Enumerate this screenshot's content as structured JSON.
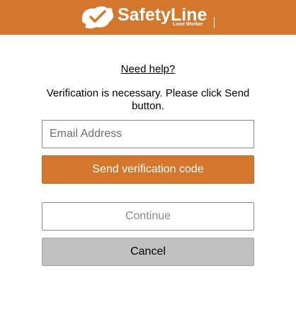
{
  "brand": {
    "name": "SafetyLine",
    "tagline": "Lone Worker",
    "color": "#d4772c",
    "icon": "safetyline-bird-logo-icon"
  },
  "help": {
    "label": "Need help?"
  },
  "message": "Verification is necessary. Please click Send button.",
  "email": {
    "placeholder": "Email Address",
    "value": ""
  },
  "buttons": {
    "send": "Send verification code",
    "continue": "Continue",
    "cancel": "Cancel"
  }
}
